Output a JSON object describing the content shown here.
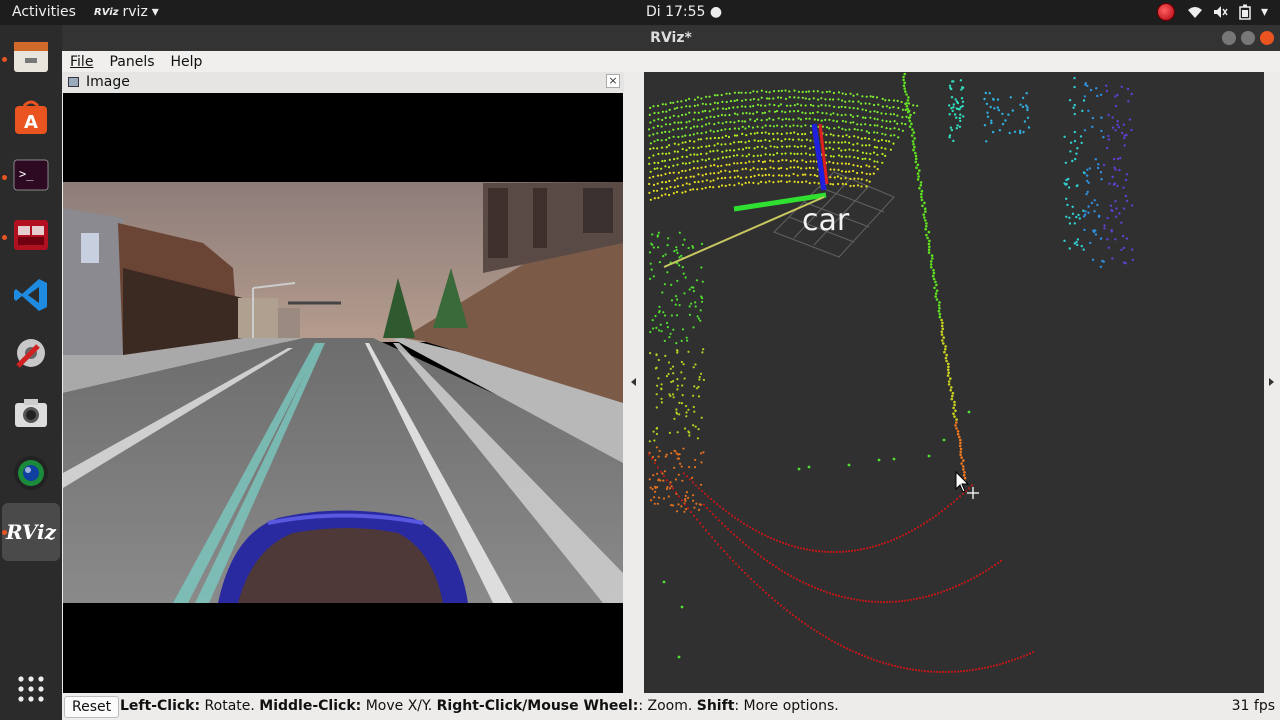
{
  "topbar": {
    "activities": "Activities",
    "app_name": "rviz",
    "app_logo": "RViz",
    "clock": "Di 17:55 ●",
    "tray_icons": [
      "record-icon",
      "wifi-icon",
      "volume-icon",
      "battery-icon",
      "chevron-down-icon"
    ]
  },
  "dock": {
    "items": [
      "files-icon",
      "software-icon",
      "terminal-icon",
      "app-grid-red-icon",
      "vscode-icon",
      "settings-tools-icon",
      "screenshot-icon",
      "camera-lens-icon",
      "rviz-icon",
      "show-apps-icon"
    ],
    "rviz_label": "RViz"
  },
  "window": {
    "title": "RViz*"
  },
  "menu": {
    "file": "File",
    "panels": "Panels",
    "help": "Help"
  },
  "image_panel": {
    "title": "Image",
    "close": "×"
  },
  "render": {
    "frame_label": "car"
  },
  "status": {
    "reset": "Reset",
    "h1_key": "Left-Click:",
    "h1_val": " Rotate. ",
    "h2_key": "Middle-Click:",
    "h2_val": " Move X/Y. ",
    "h3_key": "Right-Click/Mouse Wheel:",
    "h3_val": ": Zoom. ",
    "h4_key": "Shift",
    "h4_val": ": More options.",
    "fps": "31 fps"
  },
  "colors": {
    "ubuntu_orange": "#e95420",
    "axis_red": "#e02020",
    "axis_green": "#20e020",
    "axis_blue": "#2020e0"
  }
}
